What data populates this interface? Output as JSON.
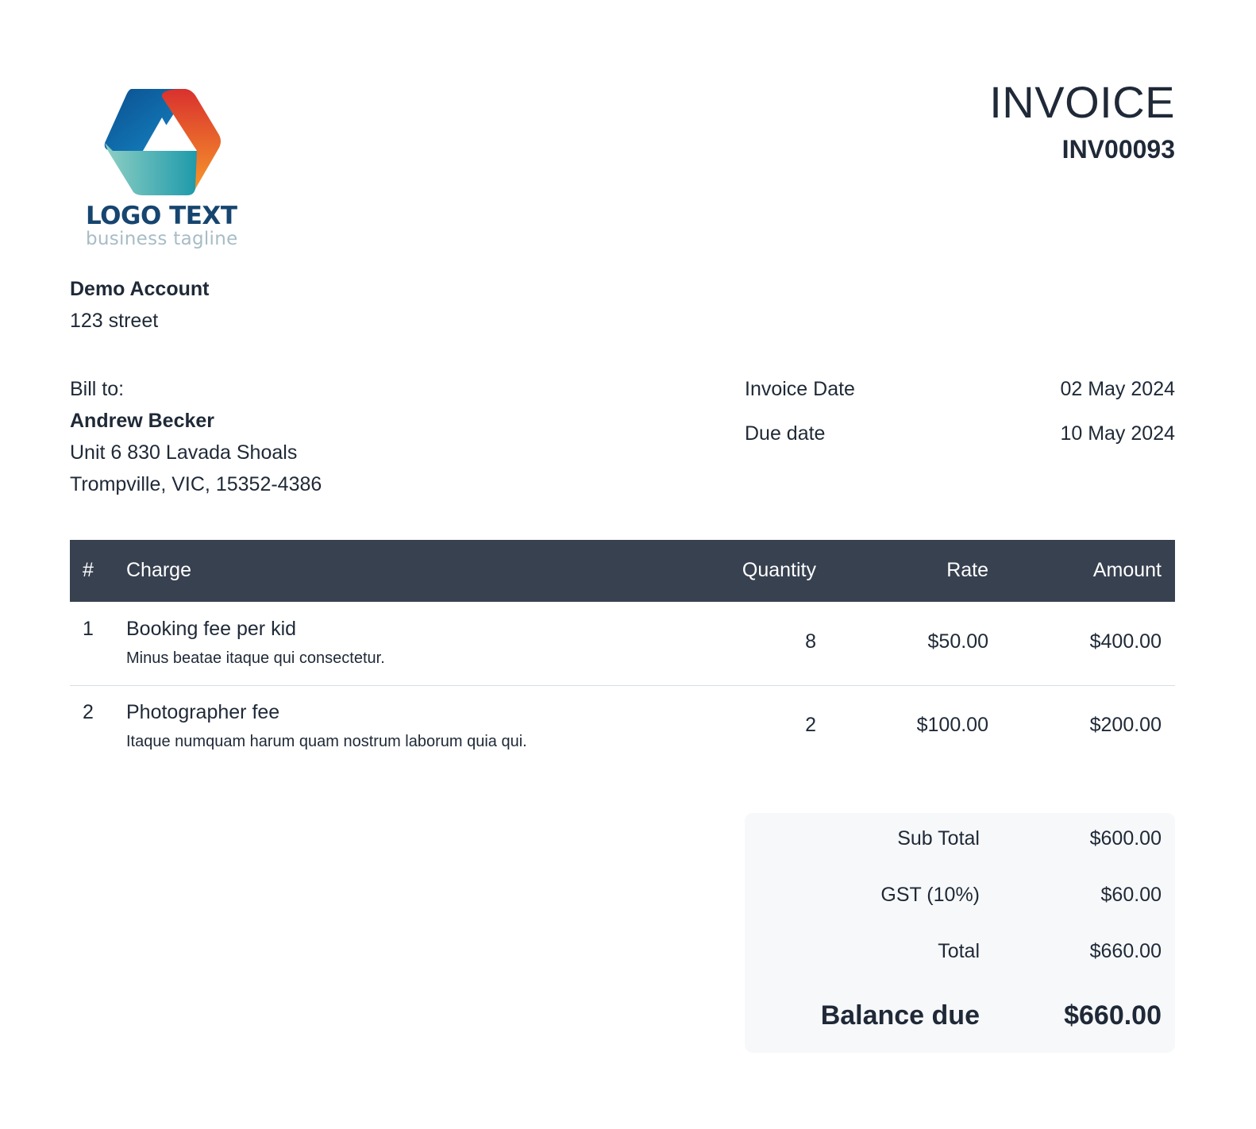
{
  "logo": {
    "text": "LOGO TEXT",
    "tagline": "business tagline",
    "colors": {
      "blue": "#0f5a9c",
      "teal": "#3fb0b0",
      "orange": "#f47b2a",
      "red": "#e2452f"
    }
  },
  "invoice": {
    "title": "INVOICE",
    "number": "INV00093"
  },
  "from": {
    "name": "Demo Account",
    "street": "123 street"
  },
  "bill_to": {
    "label": "Bill to:",
    "name": "Andrew Becker",
    "address_line1": "Unit 6 830 Lavada Shoals",
    "address_line2": "Trompville, VIC, 15352-4386"
  },
  "meta": {
    "invoice_date_label": "Invoice Date",
    "invoice_date": "02 May 2024",
    "due_date_label": "Due date",
    "due_date": "10 May 2024"
  },
  "table": {
    "headers": {
      "num": "#",
      "charge": "Charge",
      "quantity": "Quantity",
      "rate": "Rate",
      "amount": "Amount"
    },
    "header_bg": "#384150",
    "rows": [
      {
        "num": "1",
        "name": "Booking fee per kid",
        "description": "Minus beatae itaque qui consectetur.",
        "quantity": "8",
        "rate": "$50.00",
        "amount": "$400.00"
      },
      {
        "num": "2",
        "name": "Photographer fee",
        "description": "Itaque numquam harum quam nostrum laborum quia qui.",
        "quantity": "2",
        "rate": "$100.00",
        "amount": "$200.00"
      }
    ]
  },
  "totals": {
    "subtotal_label": "Sub Total",
    "subtotal": "$600.00",
    "gst_label": "GST (10%)",
    "gst": "$60.00",
    "total_label": "Total",
    "total": "$660.00",
    "balance_label": "Balance due",
    "balance": "$660.00"
  }
}
